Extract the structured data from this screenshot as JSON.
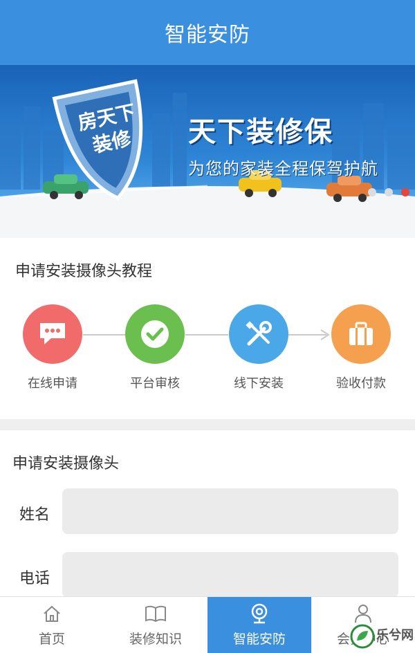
{
  "header": {
    "title": "智能安防"
  },
  "banner": {
    "shield_text": "房天下\n装修",
    "headline": "天下装修保",
    "subline": "为您的家装全程保驾护航",
    "carousel_dots": 3,
    "active_dot": 2
  },
  "tutorial": {
    "title": "申请安装摄像头教程",
    "steps": [
      {
        "label": "在线申请",
        "icon": "chat-bubble-icon",
        "color": "#f26b6b"
      },
      {
        "label": "平台审核",
        "icon": "check-icon",
        "color": "#6bbf4e"
      },
      {
        "label": "线下安装",
        "icon": "tools-icon",
        "color": "#4aa8e8"
      },
      {
        "label": "验收付款",
        "icon": "suitcase-icon",
        "color": "#f5a04f"
      }
    ]
  },
  "form": {
    "title": "申请安装摄像头",
    "name_label": "姓名",
    "name_value": "",
    "phone_label": "电话",
    "phone_value": ""
  },
  "tabbar": {
    "items": [
      {
        "label": "首页",
        "icon": "home-icon",
        "active": false
      },
      {
        "label": "装修知识",
        "icon": "book-icon",
        "active": false
      },
      {
        "label": "智能安防",
        "icon": "camera-icon",
        "active": true
      },
      {
        "label": "会员中心",
        "icon": "user-icon",
        "active": false
      }
    ]
  },
  "watermark": {
    "text": "乐兮网"
  },
  "colors": {
    "primary": "#3a8fdf",
    "active_dot": "#e8443a"
  }
}
